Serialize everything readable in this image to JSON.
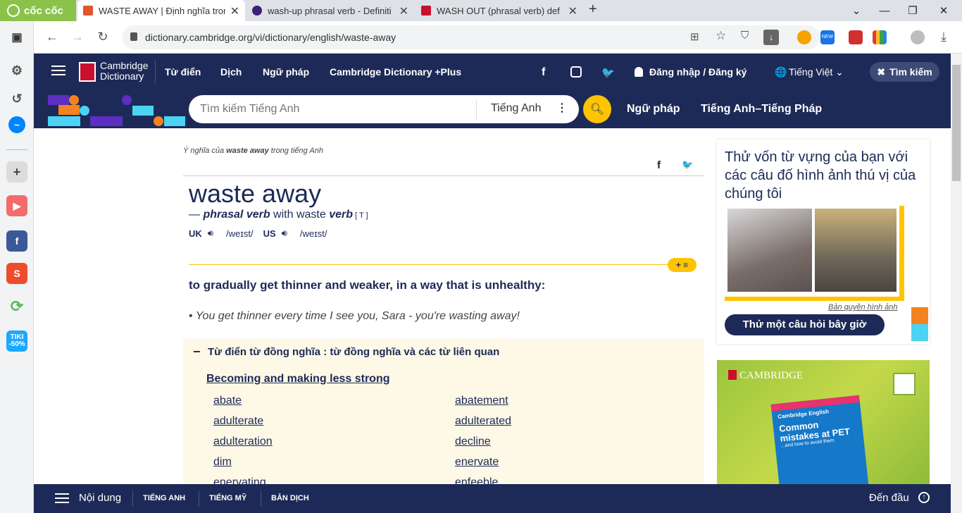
{
  "browser": {
    "logo_text": "cốc cốc",
    "tabs": [
      {
        "title": "WASTE AWAY | Định nghĩa trong",
        "favicon_color": "#e0562e"
      },
      {
        "title": "wash-up phrasal verb - Definiti",
        "favicon_color": "#3c1f7a"
      },
      {
        "title": "WASH OUT (phrasal verb) def",
        "favicon_color": "#c8102e"
      }
    ],
    "new_tab": "+",
    "url": "dictionary.cambridge.org/vi/dictionary/english/waste-away"
  },
  "nav": {
    "logo_line1": "Cambridge",
    "logo_line2": "Dictionary",
    "items": [
      "Từ điển",
      "Dịch",
      "Ngữ pháp",
      "Cambridge Dictionary +Plus"
    ],
    "login": "Đăng nhập / Đăng ký",
    "language": "Tiếng Việt",
    "search_button": "Tìm kiếm"
  },
  "search": {
    "placeholder": "Tìm kiếm Tiếng Anh",
    "lang": "Tiếng Anh",
    "links": [
      "Ngữ pháp",
      "Tiếng Anh–Tiếng Pháp"
    ]
  },
  "entry": {
    "breadcrumb_prefix": "Ý nghĩa của ",
    "breadcrumb_word": "waste away",
    "breadcrumb_suffix": " trong tiếng Anh",
    "headword": "waste away",
    "pos_dash": "— ",
    "pos": "phrasal verb",
    "pos_with": " with waste ",
    "pos_verb": "verb",
    "pos_code": " [ T ]",
    "uk_label": "UK",
    "uk_ipa": "/weɪst/",
    "us_label": "US",
    "us_ipa": "/weɪst/",
    "definition": "to gradually get thinner and weaker, in a way that is unhealthy:",
    "example": "You get thinner every time I see you, Sara - you're wasting away!",
    "list_button": "+ ≡"
  },
  "synonyms": {
    "toggle": "−",
    "heading": "Từ điển từ đồng nghĩa : từ đồng nghĩa và các từ liên quan",
    "group": "Becoming and making less strong",
    "left": [
      "abate",
      "adulterate",
      "adulteration",
      "dim",
      "enervating"
    ],
    "right": [
      "abatement",
      "adulterated",
      "decline",
      "enervate",
      "enfeeble"
    ]
  },
  "sidebar": {
    "quiz_title": "Thử vốn từ vựng của bạn với các câu đố hình ảnh thú vị của chúng tôi",
    "credit": "Bản quyền hình ảnh",
    "quiz_button": "Thử một câu hỏi bây giờ",
    "ad_brand": "CAMBRIDGE",
    "ad_book_series": "Cambridge English",
    "ad_book_title": "Common mistakes at PET",
    "ad_book_sub": "...and how to avoid them"
  },
  "bottom": {
    "contents": "Nội dung",
    "tabs": [
      "TIẾNG ANH",
      "TIẾNG MỸ",
      "BẢN DỊCH"
    ],
    "top": "Đến đầu"
  }
}
